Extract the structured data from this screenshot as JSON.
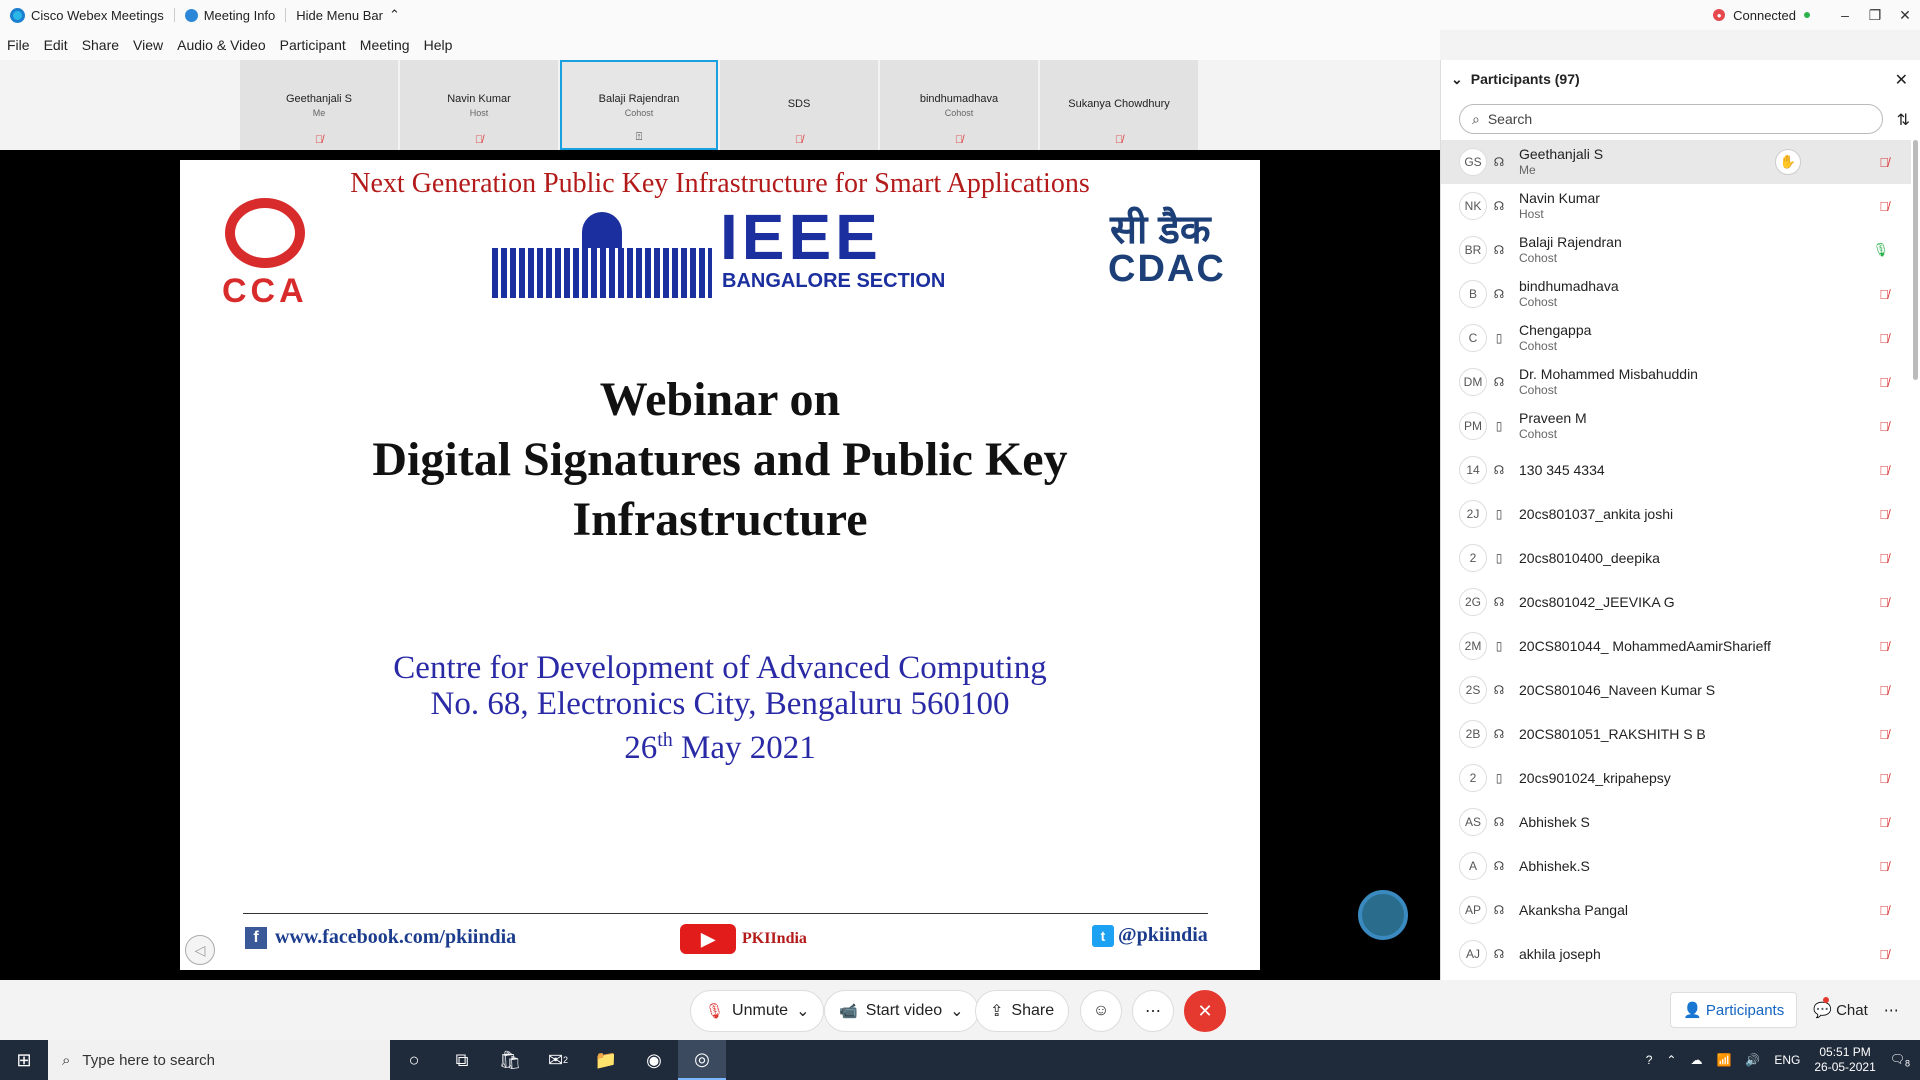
{
  "titlebar": {
    "app_name": "Cisco Webex Meetings",
    "meeting_info": "Meeting Info",
    "hide_menu": "Hide Menu Bar",
    "connection_status": "Connected"
  },
  "menu": [
    "File",
    "Edit",
    "Share",
    "View",
    "Audio & Video",
    "Participant",
    "Meeting",
    "Help"
  ],
  "thumbnails": [
    {
      "name": "Geethanjali S",
      "role": "Me"
    },
    {
      "name": "Navin Kumar",
      "role": "Host"
    },
    {
      "name": "Balaji Rajendran",
      "role": "Cohost"
    },
    {
      "name": "SDS",
      "role": ""
    },
    {
      "name": "bindhumadhava",
      "role": "Cohost"
    },
    {
      "name": "Sukanya Chowdhury",
      "role": ""
    }
  ],
  "slide": {
    "top_line": "Next Generation Public Key Infrastructure for Smart Applications",
    "cca_logo_text": "CCA",
    "ieee_text": "IEEE",
    "ieee_sub": "BANGALORE SECTION",
    "cdac_hindi": "सी डैक",
    "cdac_en": "CDAC",
    "title_1": "Webinar on",
    "title_2": "Digital Signatures and Public Key",
    "title_3": "Infrastructure",
    "org_1": "Centre for Development of Advanced Computing",
    "org_2": "No. 68, Electronics City, Bengaluru 560100",
    "org_3_day": "26",
    "org_3_sup": "th",
    "org_3_rest": " May 2021",
    "facebook": "www.facebook.com/pkiindia",
    "youtube": "PKIIndia",
    "twitter": "@pkiindia"
  },
  "controls": {
    "unmute": "Unmute",
    "start_video": "Start video",
    "share": "Share"
  },
  "panel": {
    "title": "Participants (97)",
    "search_placeholder": "Search",
    "participants": [
      {
        "initials": "GS",
        "name": "Geethanjali S",
        "role": "Me",
        "device": "headset"
      },
      {
        "initials": "NK",
        "name": "Navin Kumar",
        "role": "Host",
        "device": "headset"
      },
      {
        "initials": "BR",
        "name": "Balaji Rajendran",
        "role": "Cohost",
        "device": "headset"
      },
      {
        "initials": "B",
        "name": "bindhumadhava",
        "role": "Cohost",
        "device": "headset"
      },
      {
        "initials": "C",
        "name": "Chengappa",
        "role": "Cohost",
        "device": "phone"
      },
      {
        "initials": "DM",
        "name": "Dr. Mohammed Misbahuddin",
        "role": "Cohost",
        "device": "headset"
      },
      {
        "initials": "PM",
        "name": "Praveen M",
        "role": "Cohost",
        "device": "phone"
      },
      {
        "initials": "14",
        "name": "130 345 4334",
        "role": "",
        "device": "headset"
      },
      {
        "initials": "2J",
        "name": "20cs801037_ankita joshi",
        "role": "",
        "device": "phone"
      },
      {
        "initials": "2",
        "name": "20cs8010400_deepika",
        "role": "",
        "device": "phone"
      },
      {
        "initials": "2G",
        "name": "20cs801042_JEEVIKA G",
        "role": "",
        "device": "headset"
      },
      {
        "initials": "2M",
        "name": "20CS801044_ MohammedAamirSharieff",
        "role": "",
        "device": "phone"
      },
      {
        "initials": "2S",
        "name": "20CS801046_Naveen Kumar S",
        "role": "",
        "device": "headset"
      },
      {
        "initials": "2B",
        "name": "20CS801051_RAKSHITH S B",
        "role": "",
        "device": "headset"
      },
      {
        "initials": "2",
        "name": "20cs901024_kripahepsy",
        "role": "",
        "device": "phone"
      },
      {
        "initials": "AS",
        "name": "Abhishek S",
        "role": "",
        "device": "headset"
      },
      {
        "initials": "A",
        "name": "Abhishek.S",
        "role": "",
        "device": "headset"
      },
      {
        "initials": "AP",
        "name": "Akanksha Pangal",
        "role": "",
        "device": "headset"
      },
      {
        "initials": "AJ",
        "name": "akhila joseph",
        "role": "",
        "device": "headset"
      }
    ],
    "participants_btn": "Participants",
    "chat_btn": "Chat"
  },
  "taskbar": {
    "search_placeholder": "Type here to search",
    "mail_count": "2",
    "lang": "ENG",
    "time": "05:51 PM",
    "date": "26-05-2021",
    "notif_count": "8"
  }
}
